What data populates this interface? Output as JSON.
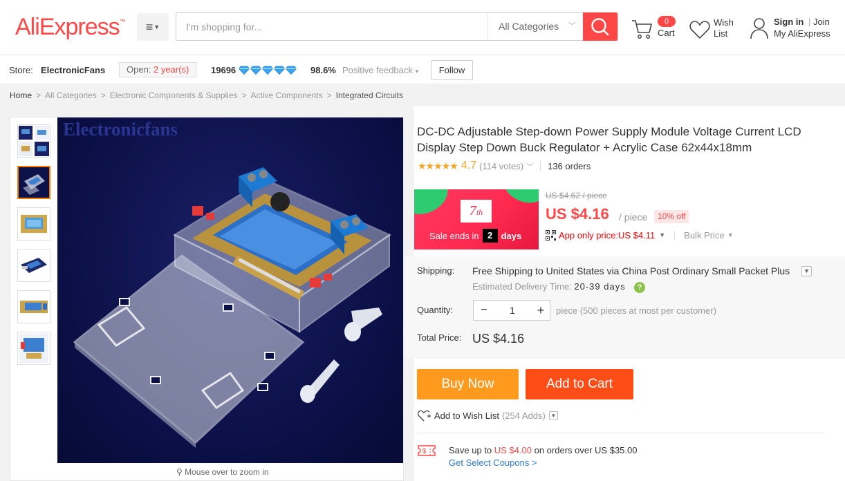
{
  "header": {
    "logo": "AliExpress",
    "search_placeholder": "I'm shopping for...",
    "search_category": "All Categories",
    "cart_count": "0",
    "cart_label": "Cart",
    "wish_line1": "Wish",
    "wish_line2": "List",
    "sign_in": "Sign in",
    "join": "Join",
    "my_account": "My AliExpress"
  },
  "store": {
    "label": "Store:",
    "name": "ElectronicFans",
    "open_prefix": "Open:",
    "open_years": "2 year(s)",
    "score": "19696",
    "diamond_count": 5,
    "positive_rate": "98.6%",
    "feedback_label": "Positive feedback",
    "follow_label": "Follow"
  },
  "breadcrumb": [
    "Home",
    "All Categories",
    "Electronic Components & Supplies",
    "Active Components",
    "Integrated Circuits"
  ],
  "gallery": {
    "watermark": "Electronicfans",
    "zoom_hint": "Mouse over to zoom in",
    "thumb_count": 6,
    "active_thumb": 1
  },
  "product": {
    "title": "DC-DC Adjustable Step-down Power Supply Module Voltage Current LCD Display Step Down Buck Regulator + Acrylic Case 62x44x18mm",
    "rating": "4.7",
    "votes": "(114 votes)",
    "orders": "136 orders",
    "promo_badge": "7",
    "promo_badge_suffix": "th",
    "promo_ends_label": "Sale ends in",
    "promo_days_num": "2",
    "promo_days_label": "days",
    "old_price": "US $4.62 / piece",
    "price": "US $4.16",
    "per_piece": "/ piece",
    "discount": "10% off",
    "app_price": "App only price:US $4.11",
    "bulk_price": "Bulk Price",
    "shipping_label": "Shipping:",
    "shipping_free": "Free Shipping",
    "shipping_rest": " to United States via China Post Ordinary Small Packet Plus",
    "est_label": "Estimated Delivery Time:",
    "est_value": "20-39 days",
    "quantity_label": "Quantity:",
    "quantity_value": "1",
    "quantity_note": "piece (500 pieces at most per customer)",
    "total_label": "Total Price:",
    "total_value": "US $4.16",
    "buy_now": "Buy Now",
    "add_to_cart": "Add to Cart",
    "add_wishlist": "Add to Wish List",
    "wishlist_count": "(254 Adds)",
    "coupon_prefix": "Save up to",
    "coupon_amount": "US $4.00",
    "coupon_suffix": "on orders over US $35.00",
    "coupon_link": "Get Select Coupons >"
  },
  "colors": {
    "brand": "#ff4747",
    "buy_now": "#ff9a1f",
    "add_to_cart": "#ff4d18",
    "link": "#2b7bd6",
    "star": "#f5a623"
  }
}
